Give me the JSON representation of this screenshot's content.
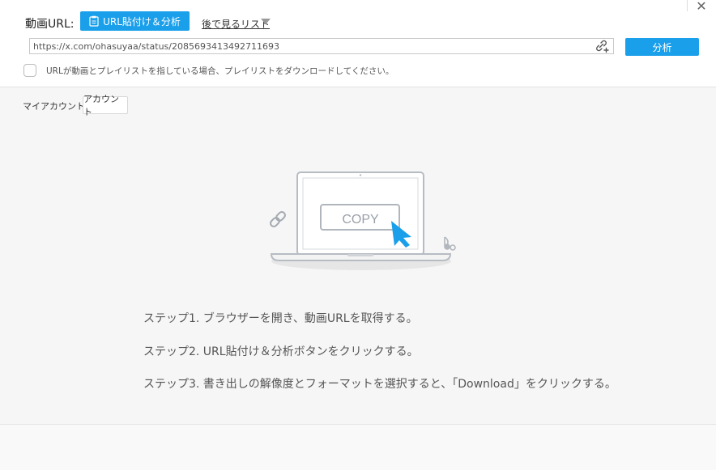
{
  "header": {
    "url_label": "動画URL:",
    "paste_button_label": "URL貼付け＆分析",
    "watch_later_label": "後で見るリスト",
    "close_glyph": "✕"
  },
  "url_field": {
    "value": "https://x.com/ohasuyaa/status/2085693413492711693",
    "placeholder": ""
  },
  "analyze_button_label": "分析",
  "playlist_checkbox": {
    "checked": false,
    "label": "URLが動画とプレイリストを指している場合、プレイリストをダウンロードしてください。"
  },
  "account": {
    "label": "マイアカウント",
    "button_label": "アカウント"
  },
  "illustration": {
    "copy_text": "COPY"
  },
  "steps": [
    "ステップ1. ブラウザーを開き、動画URLを取得する。",
    "ステップ2. URL貼付け＆分析ボタンをクリックする。",
    "ステップ3. 書き出しの解像度とフォーマットを選択すると、「Download」をクリックする。"
  ],
  "colors": {
    "accent": "#1a9fea",
    "background": "#f6f6f6",
    "panel": "#ffffff"
  },
  "icons": {
    "paste": "clipboard-icon",
    "link": "link-add-icon",
    "close": "close-icon",
    "caret": "caret-down-icon"
  }
}
